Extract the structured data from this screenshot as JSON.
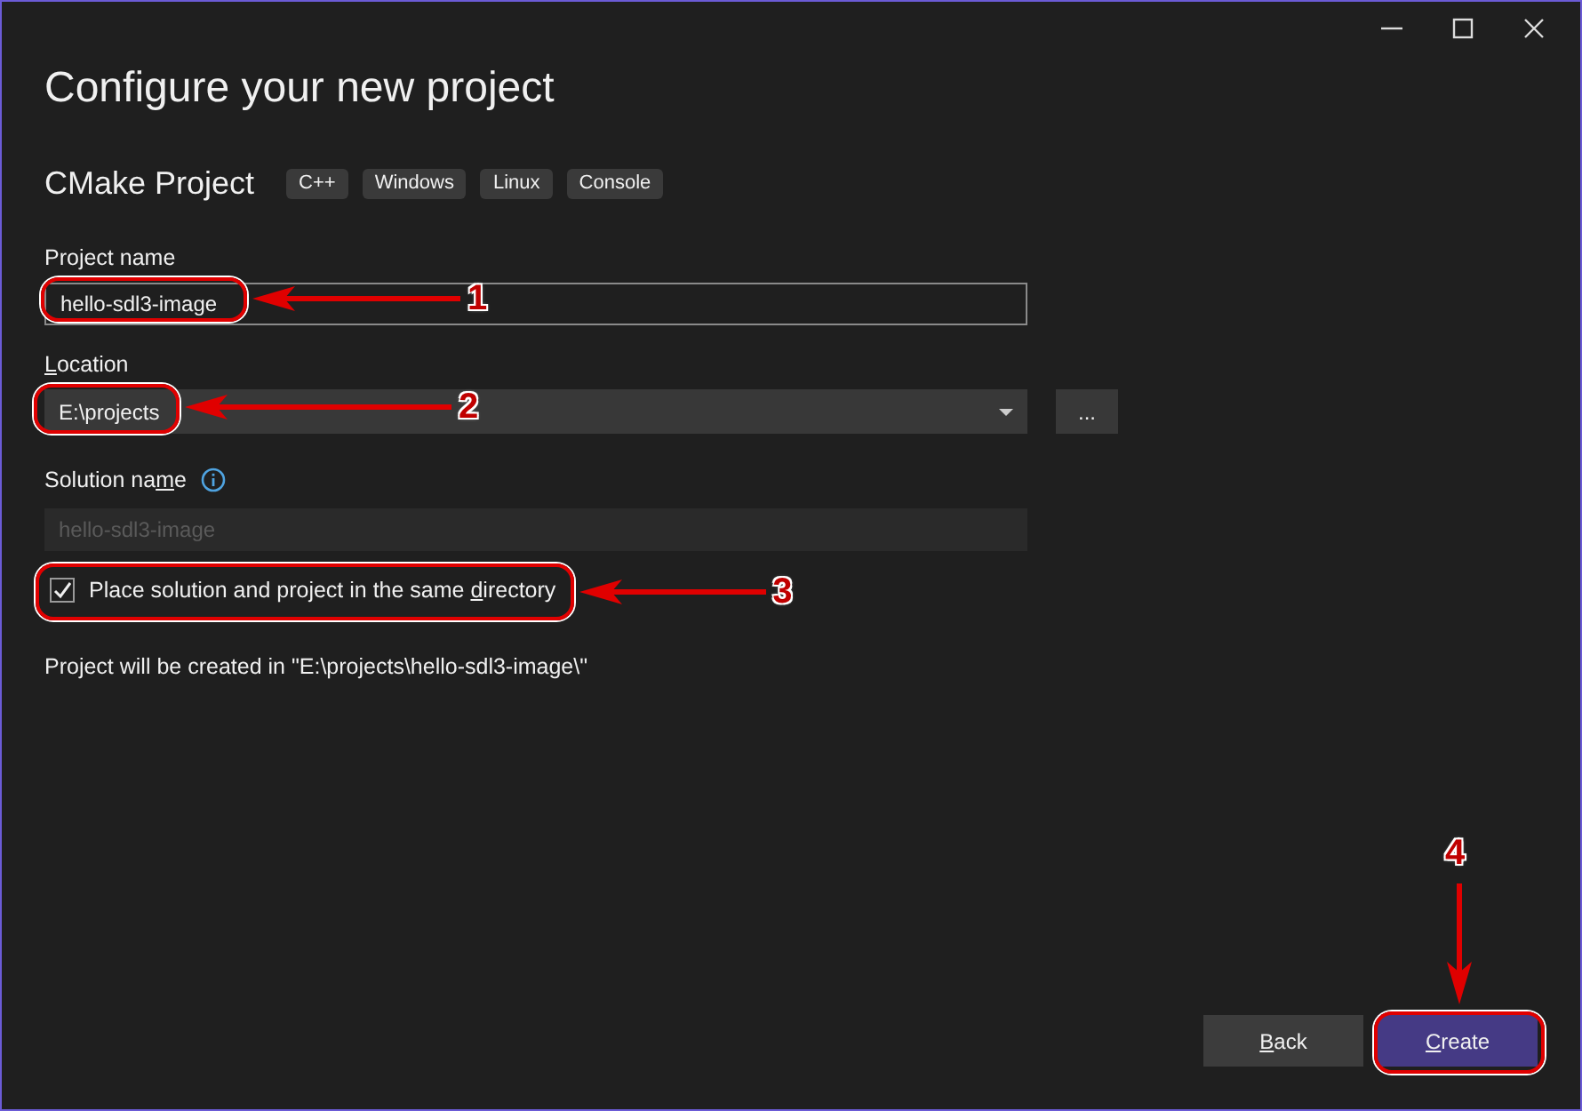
{
  "window": {
    "title": "Configure your new project"
  },
  "template": {
    "name": "CMake Project",
    "tags": [
      "C++",
      "Windows",
      "Linux",
      "Console"
    ]
  },
  "project_name": {
    "label": "Project name",
    "value": "hello-sdl3-image"
  },
  "location": {
    "label": [
      {
        "text": "L",
        "underline": true
      },
      {
        "text": "ocation",
        "underline": false
      }
    ],
    "value": "E:\\projects",
    "browse_button": "..."
  },
  "solution_name": {
    "label": [
      {
        "text": "Solution na",
        "underline": false
      },
      {
        "text": "m",
        "underline": true
      },
      {
        "text": "e",
        "underline": false
      }
    ],
    "placeholder": "hello-sdl3-image",
    "disabled": true
  },
  "same_directory": {
    "label": [
      {
        "text": "Place solution and project in the same ",
        "underline": false
      },
      {
        "text": "d",
        "underline": true
      },
      {
        "text": "irectory",
        "underline": false
      }
    ],
    "checked": true
  },
  "info_text": "Project will be created in \"E:\\projects\\hello-sdl3-image\\\"",
  "buttons": [
    {
      "label": [
        {
          "text": "B",
          "underline": true
        },
        {
          "text": "ack",
          "underline": false
        }
      ],
      "kind": "secondary"
    },
    {
      "label": [
        {
          "text": "C",
          "underline": true
        },
        {
          "text": "reate",
          "underline": false
        }
      ],
      "kind": "primary"
    }
  ],
  "annotations": [
    {
      "number": "1"
    },
    {
      "number": "2"
    },
    {
      "number": "3"
    },
    {
      "number": "4"
    }
  ]
}
